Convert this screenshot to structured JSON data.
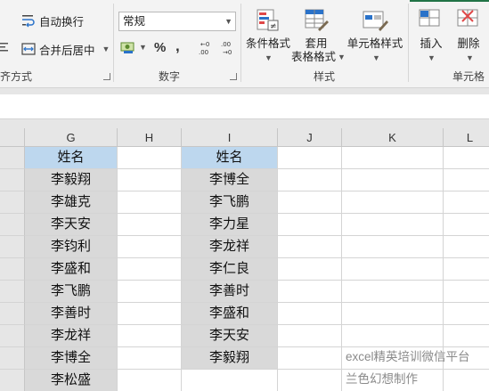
{
  "ribbon": {
    "alignment": {
      "wrap_text_label": "自动换行",
      "merge_center_label": "合并后居中",
      "group_label": "齐方式"
    },
    "number": {
      "format_value": "常规",
      "percent_symbol": "%",
      "comma_symbol": ",",
      "group_label": "数字"
    },
    "styles": {
      "conditional_format_label": "条件格式",
      "table_format_line1": "套用",
      "table_format_line2": "表格格式",
      "cell_styles_label": "单元格样式",
      "group_label": "样式"
    },
    "cells": {
      "insert_label": "插入",
      "delete_label": "删除",
      "group_label": "单元格"
    }
  },
  "sheet": {
    "columns": [
      "G",
      "H",
      "I",
      "J",
      "K",
      "L"
    ],
    "col_g": [
      "姓名",
      "李毅翔",
      "李雄克",
      "李天安",
      "李钧利",
      "李盛和",
      "李飞鹏",
      "李善时",
      "李龙祥",
      "李博全",
      "李松盛"
    ],
    "col_i": [
      "姓名",
      "李博全",
      "李飞鹏",
      "李力星",
      "李龙祥",
      "李仁良",
      "李善时",
      "李盛和",
      "李天安",
      "李毅翔"
    ],
    "watermark_line1": "excel精英培训微信平台",
    "watermark_line2": "兰色幻想制作"
  },
  "colors": {
    "header_fill": "#bdd7ee",
    "data_fill": "#d9d9d9",
    "excel_green": "#217346"
  }
}
